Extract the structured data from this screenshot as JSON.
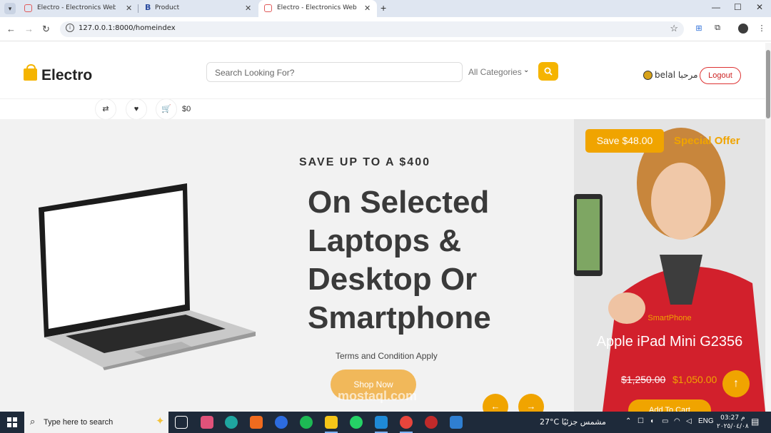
{
  "browser": {
    "tabs": [
      {
        "title": "Electro - Electronics Website Te",
        "active": false
      },
      {
        "title": "Product",
        "active": false
      },
      {
        "title": "Electro - Electronics Website Te",
        "active": true
      }
    ],
    "url": "127.0.0.1:8000/homeindex",
    "new_tab": "+",
    "minimize": "—",
    "maximize": "☐",
    "close": "✕"
  },
  "header": {
    "logo": "Electro",
    "search_placeholder": "Search Looking For?",
    "category": "All Categories",
    "user_greeting": "belal مرحبا",
    "logout": "Logout",
    "cart_total": "$0"
  },
  "hero": {
    "kicker": "SAVE UP TO A $400",
    "title": "On Selected Laptops & Desktop Or Smartphone",
    "terms": "Terms and Condition Apply",
    "cta": "Shop Now"
  },
  "offer": {
    "save": "Save $48.00",
    "label": "Special Offer",
    "category": "SmartPhone",
    "name": "Apple iPad Mini G2356",
    "old_price": "$1,250.00",
    "new_price": "$1,050.00",
    "cta": "Add To Cart"
  },
  "watermark": "mostaql.com",
  "taskbar": {
    "search_placeholder": "Type here to search",
    "weather": "27°C مشمس جزئيًا",
    "lang": "ENG",
    "time": "03:27 م",
    "date": "٢٠٢٥/٠٤/٠٨"
  },
  "colors": {
    "accent": "#f0a400",
    "brand_yellow": "#f5b400",
    "logout_red": "#cc2222"
  }
}
